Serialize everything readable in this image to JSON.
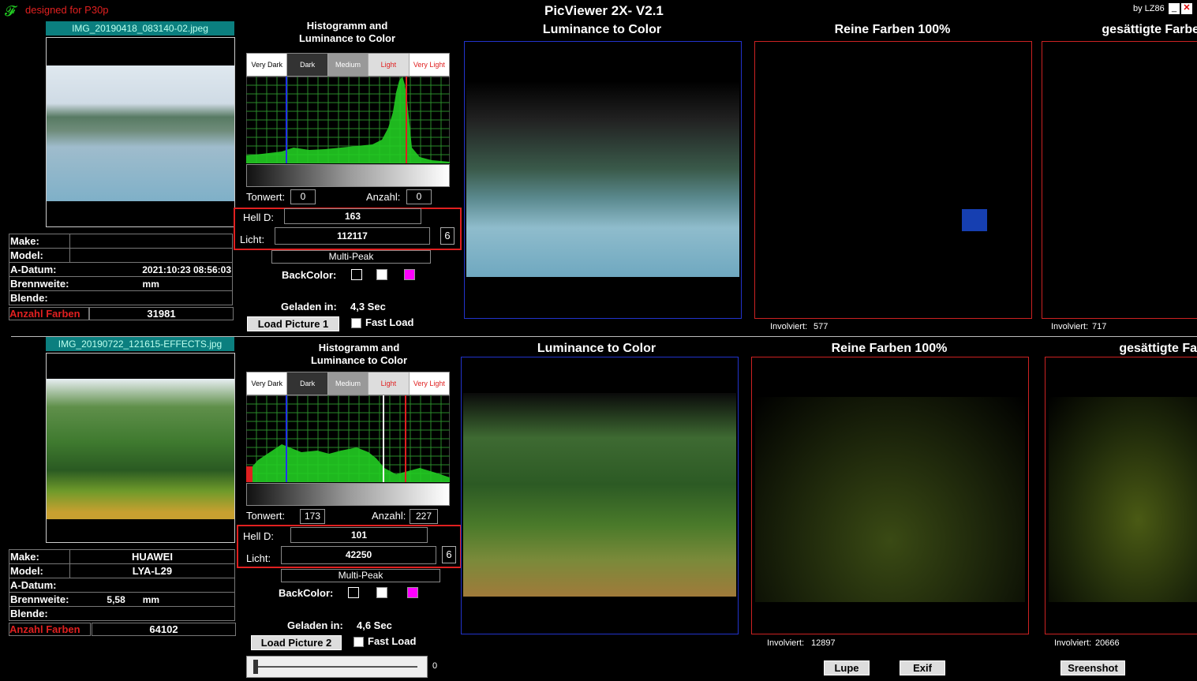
{
  "app": {
    "logo_glyph": "𝓕",
    "designed_for": "designed for P30p",
    "title": "PicViewer 2X- V2.1",
    "by": "by LZ86"
  },
  "panels": [
    {
      "filename": "IMG_20190418_083140-02.jpeg",
      "hist_title_1": "Histogramm and",
      "hist_title_2": "Luminance to Color",
      "tabs": [
        "Very Dark",
        "Dark",
        "Medium",
        "Light",
        "Very Light"
      ],
      "tonwert_label": "Tonwert:",
      "tonwert": "0",
      "anzahl_label": "Anzahl:",
      "anzahl": "0",
      "hell_label": "Hell D:",
      "hell_value": "163",
      "licht_label": "Licht:",
      "licht_value": "112117",
      "peak_count": "6",
      "multipeak": "Multi-Peak",
      "backcolor_label": "BackColor:",
      "loaded_label": "Geladen in:",
      "loaded_value": "4,3 Sec",
      "load_btn": "Load Picture 1",
      "fastload": "Fast Load",
      "info": {
        "make_label": "Make:",
        "make": "",
        "model_label": "Model:",
        "model": "",
        "date_label": "A-Datum:",
        "date": "2021:10:23 08:56:03",
        "focal_label": "Brennweite:",
        "focal": "",
        "focal_unit": "mm",
        "aperture_label": "Blende:",
        "aperture": "",
        "colors_label": "Anzahl Farben",
        "colors": "31981"
      },
      "lum_title": "Luminance to Color",
      "pure_title": "Reine Farben 100%",
      "sat_title": "gesättigte Farbe",
      "involviert_label": "Involviert:",
      "pure_involved": "577",
      "sat_involved": "717"
    },
    {
      "filename": "IMG_20190722_121615-EFFECTS.jpg",
      "hist_title_1": "Histogramm and",
      "hist_title_2": "Luminance to Color",
      "tabs": [
        "Very Dark",
        "Dark",
        "Medium",
        "Light",
        "Very Light"
      ],
      "tonwert_label": "Tonwert:",
      "tonwert": "173",
      "anzahl_label": "Anzahl:",
      "anzahl": "227",
      "hell_label": "Hell D:",
      "hell_value": "101",
      "licht_label": "Licht:",
      "licht_value": "42250",
      "peak_count": "6",
      "multipeak": "Multi-Peak",
      "backcolor_label": "BackColor:",
      "loaded_label": "Geladen in:",
      "loaded_value": "4,6 Sec",
      "load_btn": "Load Picture 2",
      "fastload": "Fast Load",
      "info": {
        "make_label": "Make:",
        "make": "HUAWEI",
        "model_label": "Model:",
        "model": "LYA-L29",
        "date_label": "A-Datum:",
        "date": "",
        "focal_label": "Brennweite:",
        "focal": "5,58",
        "focal_unit": "mm",
        "aperture_label": "Blende:",
        "aperture": "",
        "colors_label": "Anzahl Farben",
        "colors": "64102"
      },
      "lum_title": "Luminance to Color",
      "pure_title": "Reine Farben 100%",
      "sat_title": "gesättigte Fa",
      "involviert_label": "Involviert:",
      "pure_involved": "12897",
      "sat_involved": "20666"
    }
  ],
  "slider_value": "0",
  "bottom_buttons": {
    "lupe": "Lupe",
    "exif": "Exif",
    "screenshot": "Sreenshot"
  },
  "colors": {
    "accent_teal": "#0b7f7f",
    "red_frame": "#cc2222",
    "blue_frame": "#2233cc",
    "magenta": "#ff00ff",
    "histogram_green": "#22cc22"
  }
}
